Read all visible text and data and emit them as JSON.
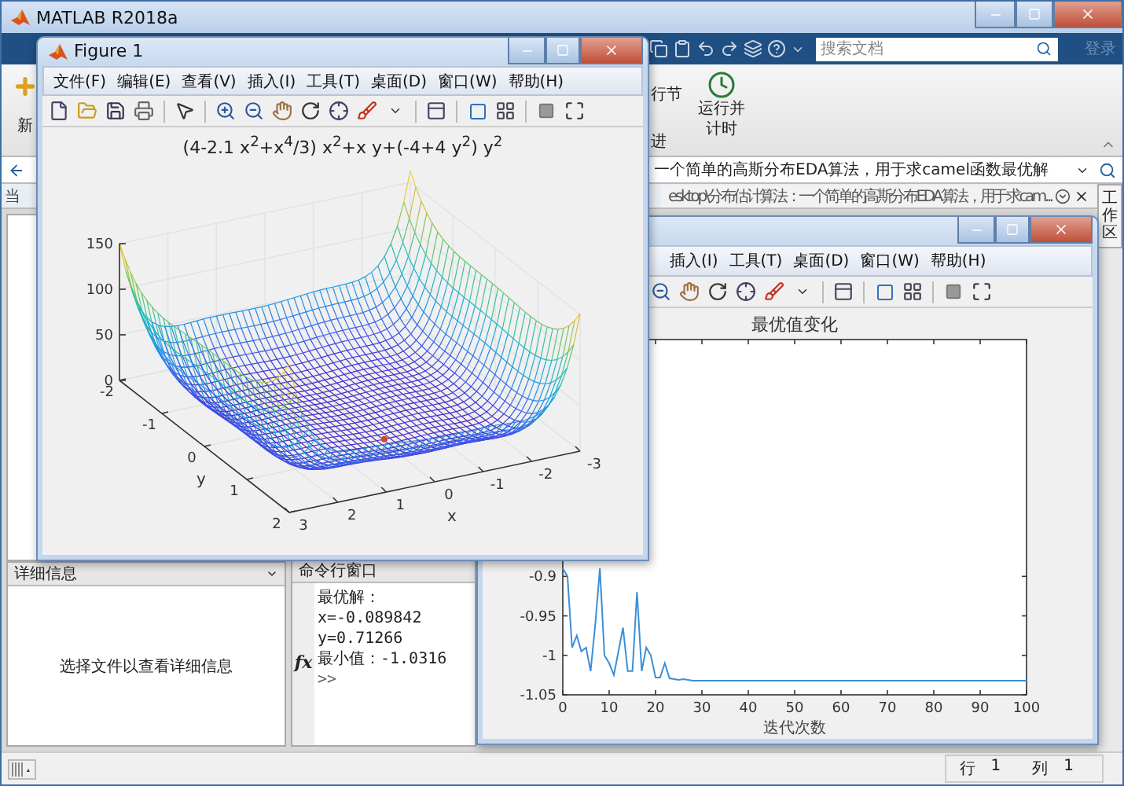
{
  "main_window": {
    "title": "MATLAB R2018a"
  },
  "quick_access": {
    "search": {
      "placeholder": "搜索文档"
    },
    "login": "登录"
  },
  "ribbon": {
    "left_label": "新",
    "labels": [
      "行节",
      "进"
    ],
    "run_and_time": [
      "运行并",
      "计时"
    ]
  },
  "address_bar": {
    "path": "一个简单的高斯分布EDA算法，用于求camel函数最优解"
  },
  "current_folder_label": "当",
  "editor_tab": {
    "title": "esktop\\分布估计算法：一个简单的高斯分布EDA算法，用于求cam..."
  },
  "side_tab": "工作区",
  "details_panel": {
    "header": "详细信息",
    "message": "选择文件以查看详细信息"
  },
  "command_window": {
    "header": "命令行窗口",
    "lines": [
      "最优解：",
      "x=-0.089842",
      "y=0.71266",
      "最小值：-1.0316"
    ],
    "fx": "fx",
    "prompt": ">>"
  },
  "status_bar": [
    {
      "label": "行",
      "value": "1"
    },
    {
      "label": "列",
      "value": "1"
    }
  ],
  "figure_1": {
    "title": "Figure 1",
    "menus": [
      "文件(F)",
      "编辑(E)",
      "查看(V)",
      "插入(I)",
      "工具(T)",
      "桌面(D)",
      "窗口(W)",
      "帮助(H)"
    ],
    "plot": {
      "title": "(4-2.1 x$^{2}$+x$^{4}$/3) x$^{2}$+x y+(-4+4 y$^{2}$) y$^{2}$",
      "z_ticks": [
        "150",
        "100",
        "50",
        "0"
      ],
      "y_ticks": [
        "-2",
        "-1",
        "0",
        "1",
        "2"
      ],
      "x_ticks": [
        "3",
        "2",
        "1",
        "0",
        "-1",
        "-2",
        "-3"
      ],
      "xlabel": "x",
      "ylabel": "y"
    }
  },
  "figure_2": {
    "menus": [
      "插入(I)",
      "工具(T)",
      "桌面(D)",
      "窗口(W)",
      "帮助(H)"
    ],
    "chart_data": {
      "type": "line",
      "title": "最优值变化",
      "xlabel": "迭代次数",
      "x": [
        0,
        1,
        2,
        3,
        4,
        5,
        6,
        7,
        8,
        9,
        10,
        11,
        12,
        13,
        14,
        15,
        16,
        17,
        18,
        19,
        20,
        21,
        22,
        23,
        24,
        25,
        26,
        27,
        28,
        29,
        30,
        31,
        32,
        33,
        34,
        35,
        36,
        37,
        38,
        39,
        40,
        41,
        42,
        43,
        44,
        45,
        46,
        47,
        48,
        49,
        50,
        51,
        52,
        53,
        54,
        55,
        56,
        57,
        58,
        59,
        60,
        61,
        62,
        63,
        64,
        65,
        66,
        67,
        68,
        69,
        70,
        71,
        72,
        73,
        74,
        75,
        76,
        77,
        78,
        79,
        80,
        81,
        82,
        83,
        84,
        85,
        86,
        87,
        88,
        89,
        90,
        91,
        92,
        93,
        94,
        95,
        96,
        97,
        98,
        99,
        100
      ],
      "xlim": [
        0,
        100
      ],
      "ylim": [
        -1.05,
        -0.6
      ],
      "xticks": [
        0,
        10,
        20,
        30,
        40,
        50,
        60,
        70,
        80,
        90,
        100
      ],
      "yticks": [
        -1.05,
        -1,
        -0.95,
        -0.9
      ],
      "series": [
        {
          "color": "#3a8fd8",
          "values": [
            -0.89,
            -0.9,
            -0.99,
            -0.975,
            -0.995,
            -0.99,
            -1.02,
            -0.96,
            -0.89,
            -1.0,
            -1.01,
            -1.025,
            -0.995,
            -0.965,
            -1.02,
            -1.02,
            -0.92,
            -1.02,
            -0.99,
            -1.0,
            -1.028,
            -1.028,
            -1.01,
            -1.029,
            -1.03,
            -1.031,
            -1.03,
            -1.031,
            -1.032,
            -1.032,
            -1.032,
            -1.032,
            -1.032,
            -1.032,
            -1.032,
            -1.032,
            -1.032,
            -1.032,
            -1.032,
            -1.032,
            -1.032,
            -1.032,
            -1.032,
            -1.032,
            -1.032,
            -1.032,
            -1.032,
            -1.032,
            -1.032,
            -1.032,
            -1.032,
            -1.032,
            -1.032,
            -1.032,
            -1.032,
            -1.032,
            -1.032,
            -1.032,
            -1.032,
            -1.032,
            -1.032,
            -1.032,
            -1.032,
            -1.032,
            -1.032,
            -1.032,
            -1.032,
            -1.032,
            -1.032,
            -1.032,
            -1.032,
            -1.032,
            -1.032,
            -1.032,
            -1.032,
            -1.032,
            -1.032,
            -1.032,
            -1.032,
            -1.032,
            -1.032,
            -1.032,
            -1.032,
            -1.032,
            -1.032,
            -1.032,
            -1.032,
            -1.032,
            -1.032,
            -1.032,
            -1.032,
            -1.032,
            -1.032,
            -1.032,
            -1.032,
            -1.032,
            -1.032,
            -1.032,
            -1.032,
            -1.032,
            -1.032
          ]
        }
      ]
    }
  }
}
